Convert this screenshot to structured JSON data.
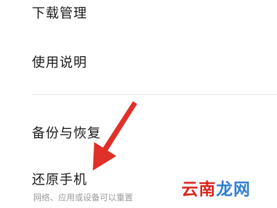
{
  "menu": {
    "download_management": "下载管理",
    "instructions": "使用说明",
    "backup_restore": "备份与恢复",
    "restore_phone": "还原手机",
    "restore_phone_subtitle": "网络、应用或设备可以重置"
  },
  "annotation": {
    "arrow_color": "#e0302a",
    "arrow_icon": "red-arrow-icon"
  },
  "watermark": {
    "part1": "云南",
    "part2": "龙网",
    "color1": "#d9251c",
    "color2": "#2f7fd0"
  }
}
